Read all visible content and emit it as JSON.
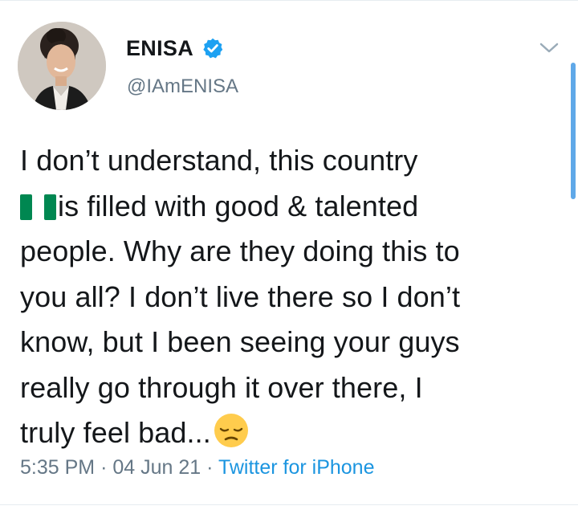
{
  "user": {
    "display_name": "ENISA",
    "handle": "@IAmENISA",
    "verified": true,
    "avatar_icon": "profile-photo"
  },
  "tweet": {
    "lines": [
      "I don’t understand, this country",
      "is filled with good & talented",
      "people. Why are they doing this to",
      "you all? I don’t live there so I don’t",
      "know, but I been seeing your guys",
      "really go through it over there, I",
      "truly feel bad..."
    ],
    "flag_emoji": "nigeria-flag-icon",
    "trailing_emoji": "pensive-face-icon"
  },
  "meta": {
    "time": "5:35 PM",
    "separator": "·",
    "date": "04 Jun 21",
    "source": "Twitter for iPhone"
  },
  "colors": {
    "text": "#14171a",
    "secondary": "#657786",
    "link": "#1b95e0",
    "verified": "#1da1f2",
    "flag_green": "#008751"
  }
}
